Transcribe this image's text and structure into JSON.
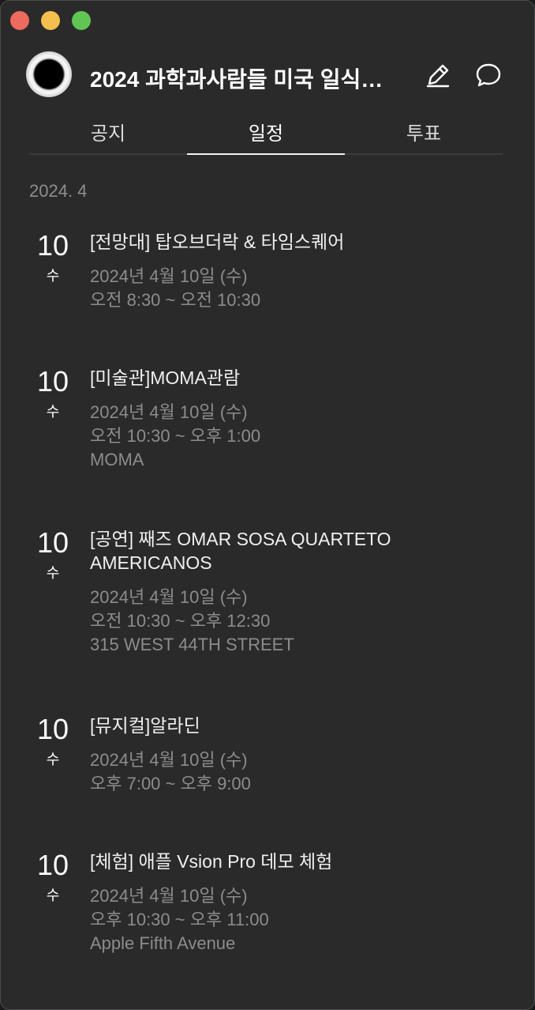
{
  "header": {
    "title": "2024 과학과사람들 미국 일식…"
  },
  "tabs": [
    {
      "label": "공지"
    },
    {
      "label": "일정"
    },
    {
      "label": "투표"
    }
  ],
  "month_label": "2024. 4",
  "events": [
    {
      "day": "10",
      "weekday": "수",
      "title": "[전망대] 탑오브더락 & 타임스퀘어",
      "date": "2024년 4월 10일 (수)",
      "time": "오전 8:30 ~ 오전 10:30",
      "location": ""
    },
    {
      "day": "10",
      "weekday": "수",
      "title": "[미술관]MOMA관람",
      "date": "2024년 4월 10일 (수)",
      "time": "오전 10:30 ~ 오후 1:00",
      "location": "MOMA"
    },
    {
      "day": "10",
      "weekday": "수",
      "title_line1": "[공연] 째즈 OMAR SOSA QUARTETO",
      "title_line2": "AMERICANOS",
      "date": "2024년 4월 10일 (수)",
      "time": "오전 10:30 ~ 오후 12:30",
      "location": "315 WEST 44TH STREET"
    },
    {
      "day": "10",
      "weekday": "수",
      "title": "[뮤지컬]알라딘",
      "date": "2024년 4월 10일 (수)",
      "time": "오후 7:00 ~ 오후 9:00",
      "location": ""
    },
    {
      "day": "10",
      "weekday": "수",
      "title": "[체험] 애플 Vsion Pro 데모 체험",
      "date": "2024년 4월 10일 (수)",
      "time": "오후 10:30 ~ 오후 11:00",
      "location": "Apple Fifth Avenue"
    }
  ],
  "icons": {
    "edit": "pencil-icon",
    "chat": "speech-bubble-icon"
  },
  "colors": {
    "background": "#2a2a2a",
    "text_primary": "#ffffff",
    "text_secondary": "#8c8c8c"
  }
}
